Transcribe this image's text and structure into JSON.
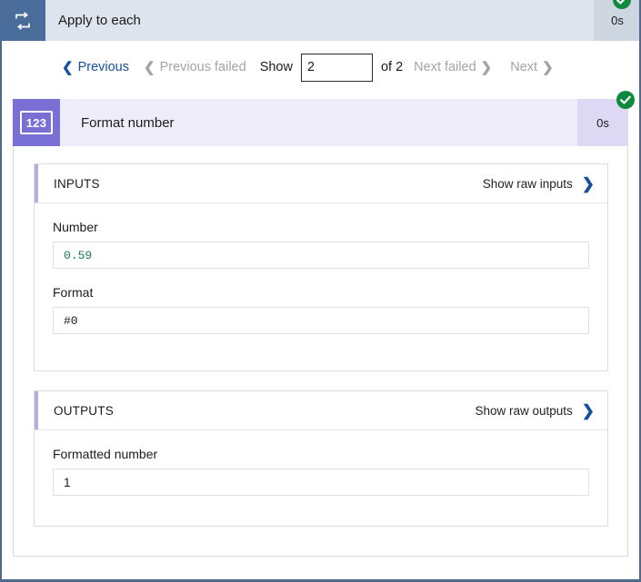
{
  "topbar": {
    "icon": "loop-repeat-icon",
    "title": "Apply to each",
    "duration": "0s",
    "status_icon": "success-check-icon"
  },
  "pager": {
    "previous_label": "Previous",
    "previous_failed_label": "Previous failed",
    "show_label": "Show",
    "show_value": "2",
    "show_placeholder": "",
    "of_label": "of 2",
    "next_failed_label": "Next failed",
    "next_label": "Next",
    "chevron_left": "❮",
    "chevron_right": "❯"
  },
  "action": {
    "icon_text": "123",
    "icon": "format-number-icon",
    "title": "Format number",
    "duration": "0s",
    "status_icon": "success-check-icon"
  },
  "sections": {
    "inputs": {
      "title": "INPUTS",
      "raw_link_label": "Show raw inputs",
      "fields": [
        {
          "label": "Number",
          "value": "0.59"
        },
        {
          "label": "Format",
          "value": "#0"
        }
      ]
    },
    "outputs": {
      "title": "OUTPUTS",
      "raw_link_label": "Show raw outputs",
      "fields": [
        {
          "label": "Formatted number",
          "value": "1"
        }
      ]
    }
  },
  "colors": {
    "topbar_bg": "#dde4ed",
    "topbar_icon_bg": "#4a6c9b",
    "action_header_bg": "#efecf9",
    "action_icon_bg": "#7a6fd4",
    "accent_purple": "#b8addf",
    "link_blue": "#15509e",
    "success_green": "#0f8a3c",
    "value_green": "#1d7a5f",
    "disabled_grey": "#a4a4a4",
    "frame_border": "#51698a"
  }
}
